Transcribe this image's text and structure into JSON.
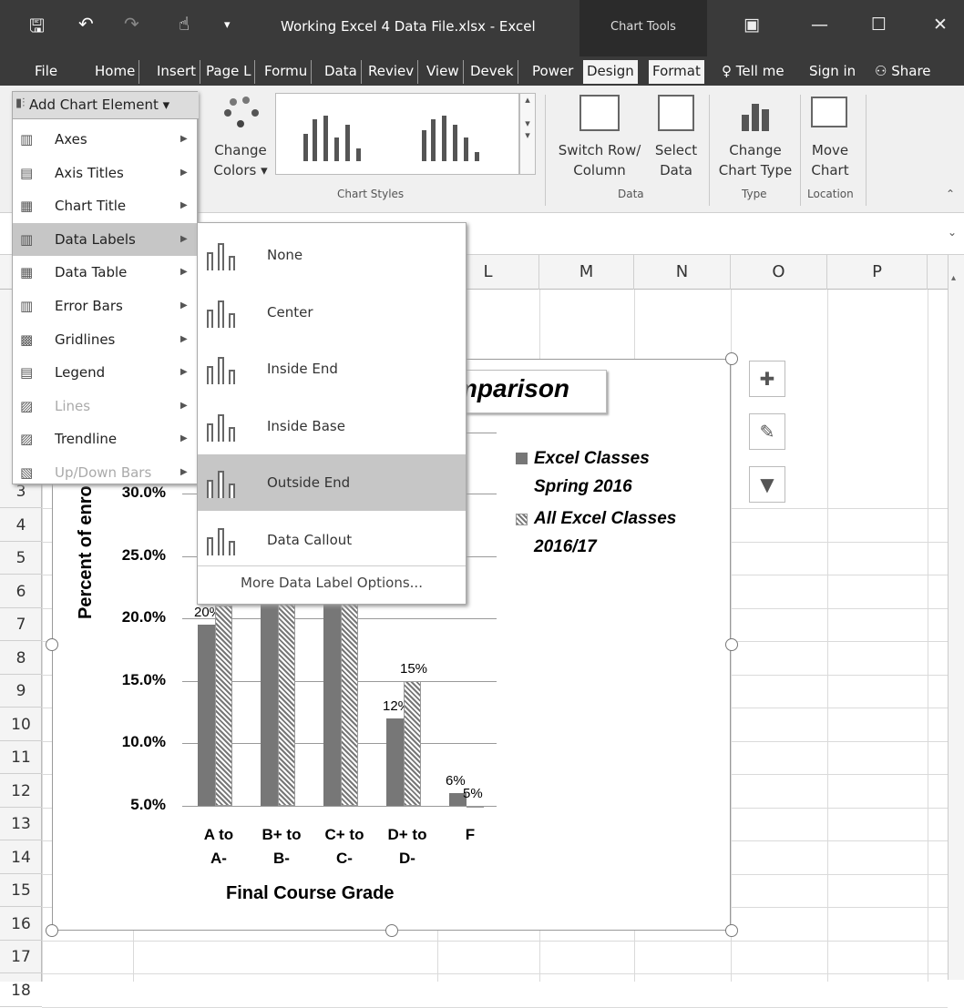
{
  "window": {
    "title": "Working Excel 4 Data File.xlsx - Excel",
    "context_tab_group": "Chart Tools"
  },
  "ribbon_tabs": [
    "File",
    "Home",
    "Insert",
    "Page L",
    "Formu",
    "Data",
    "Reviev",
    "View",
    "Devek",
    "Power",
    "Design",
    "Format"
  ],
  "ribbon_right": {
    "tell_me": "Tell me",
    "sign_in": "Sign in",
    "share": "Share"
  },
  "ribbon": {
    "add_chart_element": "Add Chart Element",
    "change_colors_line1": "Change",
    "change_colors_line2": "Colors",
    "chart_styles_caption": "Chart Styles",
    "switch_row_line1": "Switch Row/",
    "switch_row_line2": "Column",
    "select_data_line1": "Select",
    "select_data_line2": "Data",
    "data_caption": "Data",
    "change_type_line1": "Change",
    "change_type_line2": "Chart Type",
    "type_caption": "Type",
    "move_chart_line1": "Move",
    "move_chart_line2": "Chart",
    "location_caption": "Location"
  },
  "add_element_menu": [
    {
      "label": "Axes",
      "icon": "axes-icon",
      "disabled": false
    },
    {
      "label": "Axis Titles",
      "icon": "axis-titles-icon",
      "disabled": false
    },
    {
      "label": "Chart Title",
      "icon": "chart-title-icon",
      "disabled": false
    },
    {
      "label": "Data Labels",
      "icon": "data-labels-icon",
      "disabled": false,
      "selected": true
    },
    {
      "label": "Data Table",
      "icon": "data-table-icon",
      "disabled": false
    },
    {
      "label": "Error Bars",
      "icon": "error-bars-icon",
      "disabled": false
    },
    {
      "label": "Gridlines",
      "icon": "gridlines-icon",
      "disabled": false
    },
    {
      "label": "Legend",
      "icon": "legend-icon",
      "disabled": false
    },
    {
      "label": "Lines",
      "icon": "lines-icon",
      "disabled": true
    },
    {
      "label": "Trendline",
      "icon": "trendline-icon",
      "disabled": false
    },
    {
      "label": "Up/Down Bars",
      "icon": "up-down-bars-icon",
      "disabled": true
    }
  ],
  "data_labels_menu": [
    {
      "label": "None",
      "selected": false
    },
    {
      "label": "Center",
      "selected": false
    },
    {
      "label": "Inside End",
      "selected": false
    },
    {
      "label": "Inside Base",
      "selected": false
    },
    {
      "label": "Outside End",
      "selected": true
    },
    {
      "label": "Data Callout",
      "selected": false
    }
  ],
  "data_labels_more": "More Data Label Options...",
  "columns": [
    "L",
    "M",
    "N",
    "O",
    "P"
  ],
  "rows": [
    "3",
    "4",
    "5",
    "6",
    "7",
    "8",
    "9",
    "10",
    "11",
    "12",
    "13",
    "14",
    "15",
    "16",
    "17",
    "18"
  ],
  "chart_data": {
    "type": "bar",
    "title": "Comparison",
    "title_visible": "mparison",
    "xlabel": "Final Course Grade",
    "ylabel": "Percent of enrolled Excel Students",
    "ylabel_visible": "Percent of enrolled Excel Stuc",
    "ytick_labels": [
      "5.0%",
      "10.0%",
      "15.0%",
      "20.0%",
      "25.0%",
      "30.0%"
    ],
    "ylim": [
      5,
      30
    ],
    "categories": [
      [
        "A to",
        "A-"
      ],
      [
        "B+ to",
        "B-"
      ],
      [
        "C+ to",
        "C-"
      ],
      [
        "D+ to",
        "D-"
      ],
      [
        "F",
        ""
      ]
    ],
    "series": [
      {
        "name_line1": "Excel Classes",
        "name_line2": "Spring 2016",
        "values": [
          19.5,
          25,
          25,
          12,
          6
        ],
        "labels": [
          "20%",
          "",
          "",
          "12%",
          "6%"
        ]
      },
      {
        "name_line1": "All Excel Classes",
        "name_line2": "2016/17",
        "values": [
          21,
          25,
          25,
          15,
          5
        ],
        "labels": [
          "",
          "",
          "",
          "15%",
          "5%"
        ]
      }
    ],
    "legend_position": "right",
    "grid": true
  },
  "colors": {
    "titlebar": "#3a3a3a",
    "ribbon": "#f0f0f0",
    "selected": "#c6c6c6"
  }
}
